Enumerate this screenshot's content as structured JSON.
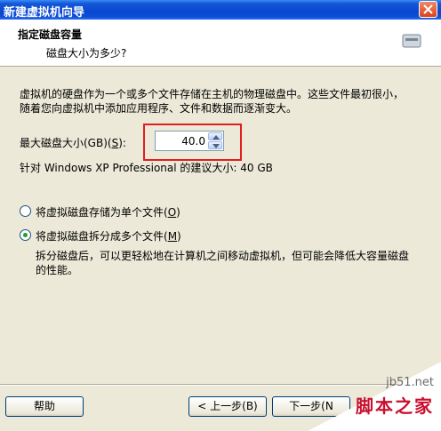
{
  "window": {
    "title": "新建虚拟机向导"
  },
  "header": {
    "title": "指定磁盘容量",
    "subtitle": "磁盘大小为多少?"
  },
  "description": "虚拟机的硬盘作为一个或多个文件存储在主机的物理磁盘中。这些文件最初很小，随着您向虚拟机中添加应用程序、文件和数据而逐渐变大。",
  "disk_size": {
    "label_prefix": "最大磁盘大小(GB)(",
    "label_key": "S",
    "label_suffix": "):",
    "value": "40.0"
  },
  "recommend_text": "针对 Windows XP Professional 的建议大小: 40 GB",
  "options": {
    "single": {
      "label_prefix": "将虚拟磁盘存储为单个文件(",
      "label_key": "O",
      "label_suffix": ")"
    },
    "split": {
      "label_prefix": "将虚拟磁盘拆分成多个文件(",
      "label_key": "M",
      "label_suffix": ")",
      "note": "拆分磁盘后，可以更轻松地在计算机之间移动虚拟机，但可能会降低大容量磁盘的性能。"
    },
    "selected": "split"
  },
  "buttons": {
    "help": "帮助",
    "back": "< 上一步(B)",
    "next": "下一步(N"
  },
  "watermark": {
    "url": "jb51.net",
    "name": "脚本之家"
  },
  "colors": {
    "accent": "#0a46cf",
    "highlight": "#e21f1f",
    "radio_dot": "#21a121"
  }
}
